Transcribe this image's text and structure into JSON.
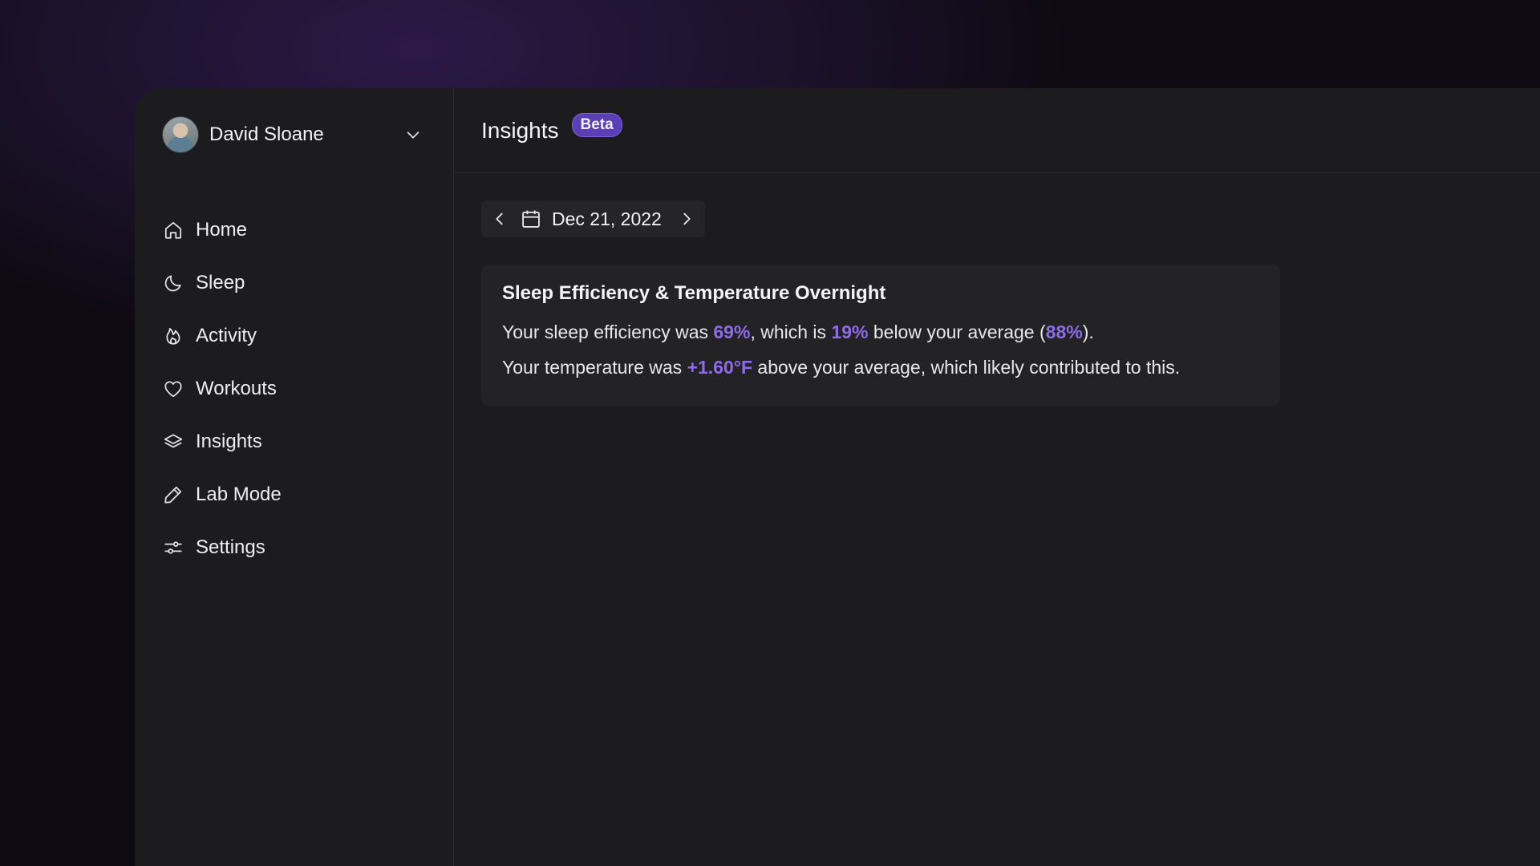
{
  "user": {
    "name": "David Sloane"
  },
  "sidebar": {
    "items": [
      {
        "label": "Home",
        "icon": "home-icon"
      },
      {
        "label": "Sleep",
        "icon": "moon-icon"
      },
      {
        "label": "Activity",
        "icon": "flame-icon"
      },
      {
        "label": "Workouts",
        "icon": "heart-icon"
      },
      {
        "label": "Insights",
        "icon": "layers-icon"
      },
      {
        "label": "Lab Mode",
        "icon": "pencil-icon"
      },
      {
        "label": "Settings",
        "icon": "sliders-icon"
      }
    ]
  },
  "header": {
    "title": "Insights",
    "badge": "Beta"
  },
  "date_nav": {
    "date": "Dec 21, 2022"
  },
  "card": {
    "title": "Sleep Efficiency & Temperature Overnight",
    "line1": {
      "t1": "Your sleep efficiency was ",
      "efficiency": "69%",
      "t2": ", which is ",
      "diff": "19%",
      "t3": " below your average (",
      "average": "88%",
      "t4": ")."
    },
    "line2": {
      "t1": "Your temperature was ",
      "temp": "+1.60°F",
      "t2": " above your average, which likely contributed to this."
    }
  },
  "colors": {
    "accent": "#8e6be8",
    "badge": "#5a3fb6",
    "panel": "#1c1c1e",
    "card": "#232325"
  }
}
